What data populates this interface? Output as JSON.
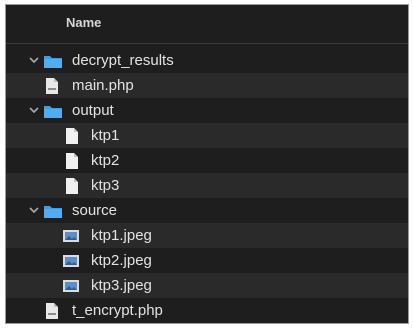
{
  "header": {
    "name_label": "Name"
  },
  "files": [
    {
      "label": "decrypt_results",
      "type": "folder",
      "expanded": true,
      "depth": 0,
      "icon": "folder-icon"
    },
    {
      "label": "main.php",
      "type": "file",
      "depth": 0,
      "icon": "php-file-icon"
    },
    {
      "label": "output",
      "type": "folder",
      "expanded": true,
      "depth": 0,
      "icon": "folder-icon"
    },
    {
      "label": "ktp1",
      "type": "file",
      "depth": 1,
      "icon": "file-icon"
    },
    {
      "label": "ktp2",
      "type": "file",
      "depth": 1,
      "icon": "file-icon"
    },
    {
      "label": "ktp3",
      "type": "file",
      "depth": 1,
      "icon": "file-icon"
    },
    {
      "label": "source",
      "type": "folder",
      "expanded": true,
      "depth": 0,
      "icon": "folder-icon"
    },
    {
      "label": "ktp1.jpeg",
      "type": "image",
      "depth": 1,
      "icon": "image-file-icon"
    },
    {
      "label": "ktp2.jpeg",
      "type": "image",
      "depth": 1,
      "icon": "image-file-icon"
    },
    {
      "label": "ktp3.jpeg",
      "type": "image",
      "depth": 1,
      "icon": "image-file-icon"
    },
    {
      "label": "t_encrypt.php",
      "type": "file",
      "depth": 0,
      "icon": "php-file-icon"
    }
  ],
  "colors": {
    "folder": "#3a9ee8",
    "background": "#1e1e1e",
    "alt_row": "#2a2a2a",
    "text": "#e2e2e2"
  }
}
